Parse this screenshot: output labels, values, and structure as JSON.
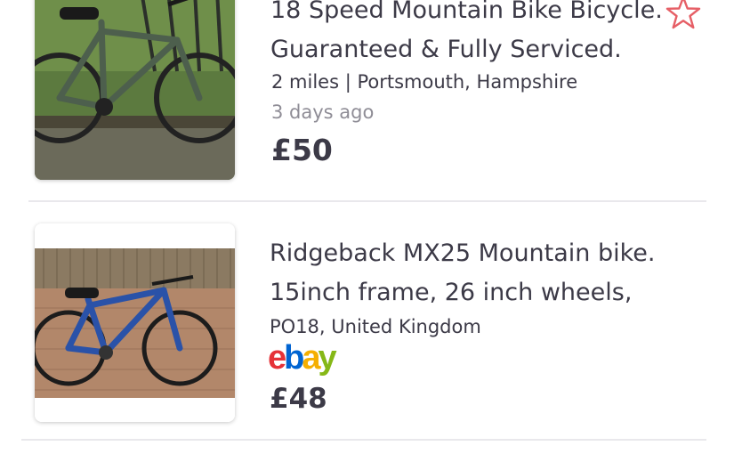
{
  "listings": [
    {
      "title_line1": "18 Speed Mountain Bike Bicycle.",
      "title_line2": "Guaranteed & Fully Serviced.",
      "location": "2 miles | Portsmouth, Hampshire",
      "age": "3 days ago",
      "price": "£50",
      "favourite_icon": "star-outline-icon",
      "thumbnail": "green-mountain-bike-photo"
    },
    {
      "title_line1": "Ridgeback MX25  Mountain bike.",
      "title_line2": "15inch frame, 26 inch wheels,",
      "location": "PO18, United Kingdom",
      "source_logo": "ebay",
      "price": "£48",
      "thumbnail": "blue-mountain-bike-photo"
    }
  ],
  "colors": {
    "text": "#3c3a47",
    "muted_text": "#8f8d96",
    "favourite_star": "#e65f66",
    "divider": "#e9e8ec"
  }
}
